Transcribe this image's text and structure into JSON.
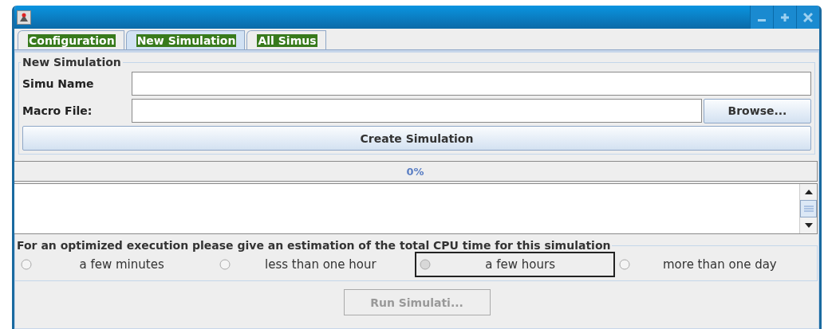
{
  "tabs": [
    {
      "label": "Configuration",
      "selected": false
    },
    {
      "label": "New Simulation",
      "selected": true
    },
    {
      "label": "All Simus",
      "selected": false
    }
  ],
  "new_simulation": {
    "title": "New Simulation",
    "fields": [
      {
        "label": "Simu Name"
      },
      {
        "label": "Macro File:",
        "button": "Browse..."
      }
    ],
    "create_button": "Create Simulation"
  },
  "progress": {
    "level": 0,
    "text": "0%"
  },
  "estimation": {
    "title": "For an optimized execution please give an estimation of the total CPU time for this simulation",
    "options": [
      {
        "label": "a few minutes",
        "selected": false
      },
      {
        "label": "less than one hour",
        "selected": false
      },
      {
        "label": "a few hours",
        "selected": true
      },
      {
        "label": "more than one day",
        "selected": false
      }
    ]
  },
  "run_button": {
    "label": "Run Simulati...",
    "disabled": true
  }
}
